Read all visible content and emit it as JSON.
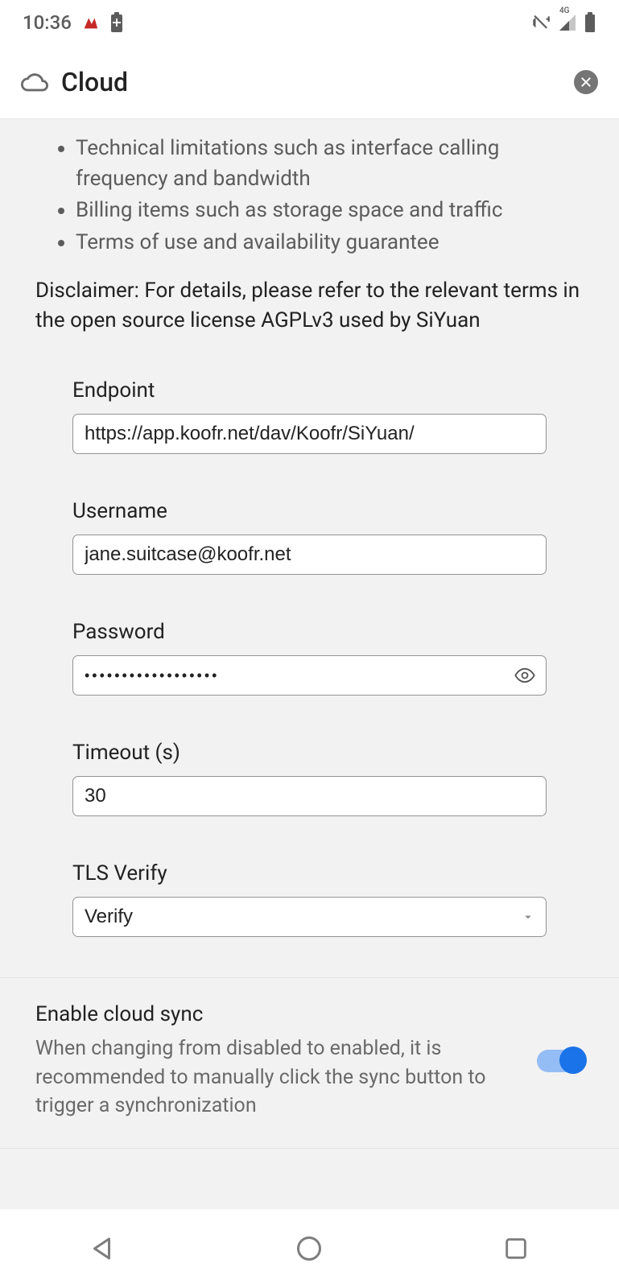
{
  "status": {
    "time": "10:36",
    "network_label": "4G"
  },
  "header": {
    "title": "Cloud"
  },
  "info": {
    "bullets": [
      "Technical limitations such as interface calling frequency and bandwidth",
      "Billing items such as storage space and traffic",
      "Terms of use and availability guarantee"
    ],
    "disclaimer": "Disclaimer: For details, please refer to the relevant terms in the open source license AGPLv3 used by SiYuan"
  },
  "form": {
    "endpoint": {
      "label": "Endpoint",
      "value": "https://app.koofr.net/dav/Koofr/SiYuan/"
    },
    "username": {
      "label": "Username",
      "value": "jane.suitcase@koofr.net"
    },
    "password": {
      "label": "Password",
      "value": "••••••••••••••••••"
    },
    "timeout": {
      "label": "Timeout (s)",
      "value": "30"
    },
    "tls": {
      "label": "TLS Verify",
      "value": "Verify"
    }
  },
  "sync": {
    "title": "Enable cloud sync",
    "desc": "When changing from disabled to enabled, it is recommended to manually click the sync button to trigger a synchronization",
    "enabled": true
  }
}
